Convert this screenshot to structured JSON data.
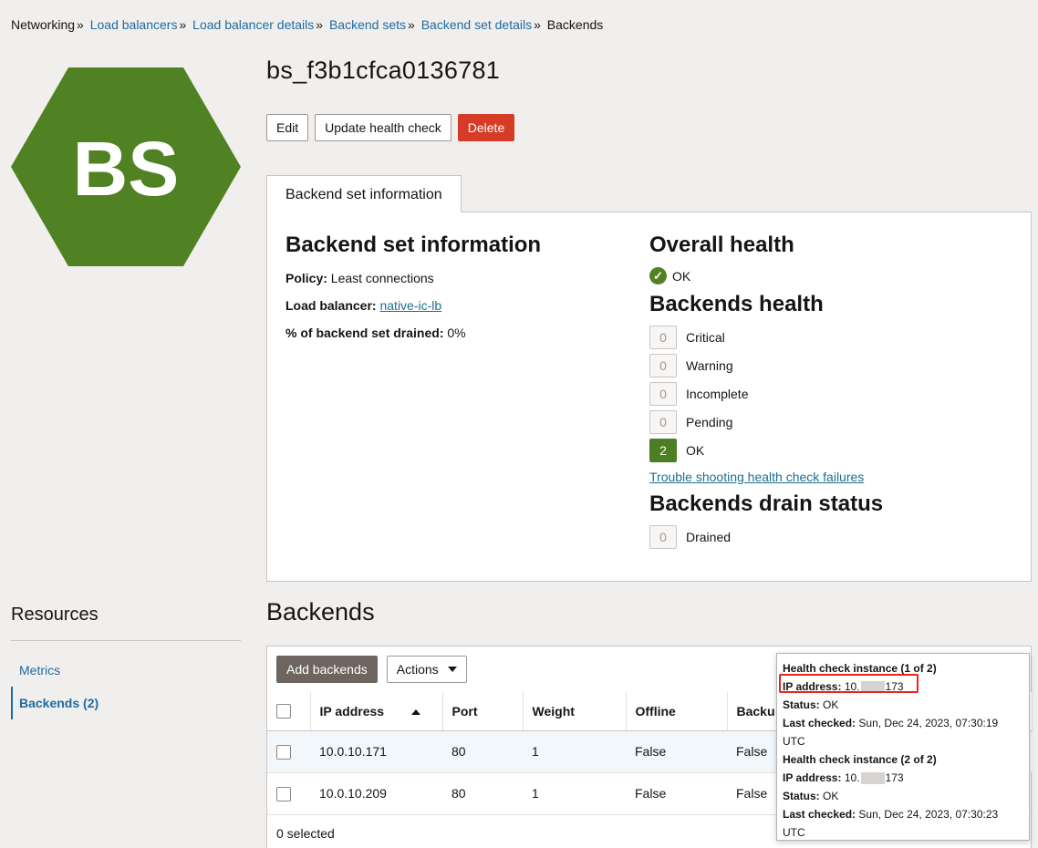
{
  "breadcrumb": {
    "items": [
      "Networking",
      "Load balancers",
      "Load balancer details",
      "Backend sets",
      "Backend set details",
      "Backends"
    ],
    "separator": "»"
  },
  "logo": {
    "initials": "BS",
    "color": "#508223"
  },
  "title": "bs_f3b1cfca0136781",
  "buttons": {
    "edit": "Edit",
    "update_health_check": "Update health check",
    "delete": "Delete"
  },
  "tab": {
    "label": "Backend set information"
  },
  "backend_set_info": {
    "heading": "Backend set information",
    "policy_label": "Policy:",
    "policy_value": "Least connections",
    "load_balancer_label": "Load balancer:",
    "load_balancer_value": "native-ic-lb",
    "drained_label": "% of backend set drained:",
    "drained_value": "0%"
  },
  "overall_health": {
    "heading": "Overall health",
    "status": "OK",
    "check_glyph": "✓"
  },
  "backends_health": {
    "heading": "Backends health",
    "rows": [
      {
        "count": "0",
        "label": "Critical"
      },
      {
        "count": "0",
        "label": "Warning"
      },
      {
        "count": "0",
        "label": "Incomplete"
      },
      {
        "count": "0",
        "label": "Pending"
      },
      {
        "count": "2",
        "label": "OK"
      }
    ],
    "trouble_link": "Trouble shooting health check failures"
  },
  "drain_status": {
    "heading": "Backends drain status",
    "count": "0",
    "label": "Drained"
  },
  "resources": {
    "title": "Resources",
    "items": [
      {
        "label": "Metrics"
      },
      {
        "label": "Backends (2)"
      }
    ]
  },
  "backends": {
    "title": "Backends",
    "add_button": "Add backends",
    "actions_button": "Actions",
    "columns": [
      "IP address",
      "Port",
      "Weight",
      "Offline",
      "Backu"
    ],
    "rows": [
      {
        "ip": "10.0.10.171",
        "port": "80",
        "weight": "1",
        "offline": "False",
        "backup": "False"
      },
      {
        "ip": "10.0.10.209",
        "port": "80",
        "weight": "1",
        "offline": "False",
        "backup": "False"
      }
    ],
    "selected_text": "0 selected"
  },
  "tooltip": {
    "instance1_title": "Health check instance (1 of 2)",
    "instance2_title": "Health check instance (2 of 2)",
    "ip_label": "IP address:",
    "ip_prefix": "10.",
    "ip_suffix": "173",
    "status_label": "Status:",
    "status_value": "OK",
    "last_checked_label": "Last checked:",
    "instance1_last_checked": "Sun, Dec 24, 2023, 07:30:19",
    "instance2_last_checked": "Sun, Dec 24, 2023, 07:30:23",
    "tz": "UTC"
  }
}
